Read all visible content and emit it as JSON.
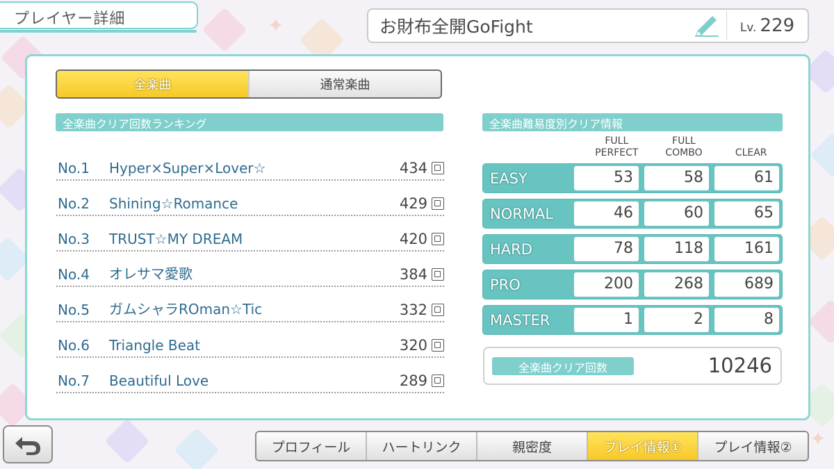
{
  "header": {
    "page_title": "プレイヤー詳細",
    "player_name": "お財布全開GoFight",
    "level_label": "Lv.",
    "level_value": "229"
  },
  "toggle": {
    "all_songs": "全楽曲",
    "normal_songs": "通常楽曲",
    "selected": "全楽曲"
  },
  "ranking": {
    "title": "全楽曲クリア回数ランキング",
    "rows": [
      {
        "no": "No.1",
        "title": "Hyper×Super×Lover☆",
        "count": "434"
      },
      {
        "no": "No.2",
        "title": "Shining☆Romance",
        "count": "429"
      },
      {
        "no": "No.3",
        "title": "TRUST☆MY DREAM",
        "count": "420"
      },
      {
        "no": "No.4",
        "title": "オレサマ愛歌",
        "count": "384"
      },
      {
        "no": "No.5",
        "title": "ガムシャラROman☆Tic",
        "count": "332"
      },
      {
        "no": "No.6",
        "title": "Triangle Beat",
        "count": "320"
      },
      {
        "no": "No.7",
        "title": "Beautiful Love",
        "count": "289"
      }
    ]
  },
  "difficulty": {
    "title": "全楽曲難易度別クリア情報",
    "columns": {
      "full_perfect_1": "FULL",
      "full_perfect_2": "PERFECT",
      "full_combo_1": "FULL",
      "full_combo_2": "COMBO",
      "clear": "CLEAR"
    },
    "rows": [
      {
        "name": "EASY",
        "fp": "53",
        "fc": "58",
        "clear": "61"
      },
      {
        "name": "NORMAL",
        "fp": "46",
        "fc": "60",
        "clear": "65"
      },
      {
        "name": "HARD",
        "fp": "78",
        "fc": "118",
        "clear": "161"
      },
      {
        "name": "PRO",
        "fp": "200",
        "fc": "268",
        "clear": "689"
      },
      {
        "name": "MASTER",
        "fp": "1",
        "fc": "2",
        "clear": "8"
      }
    ]
  },
  "total": {
    "label": "全楽曲クリア回数",
    "value": "10246"
  },
  "bottom_tabs": {
    "profile": "プロフィール",
    "heart_link": "ハートリンク",
    "intimacy": "親密度",
    "play_info_1": "プレイ情報①",
    "play_info_2": "プレイ情報②",
    "active": "プレイ情報①"
  },
  "icons": {
    "edit": "pencil-icon",
    "back": "back-arrow-icon",
    "count_unit": "kai-unit-icon"
  },
  "colors": {
    "accent_teal": "#7fcfcc",
    "active_yellow": "#f7c928",
    "rank_text": "#2f6c8f"
  }
}
